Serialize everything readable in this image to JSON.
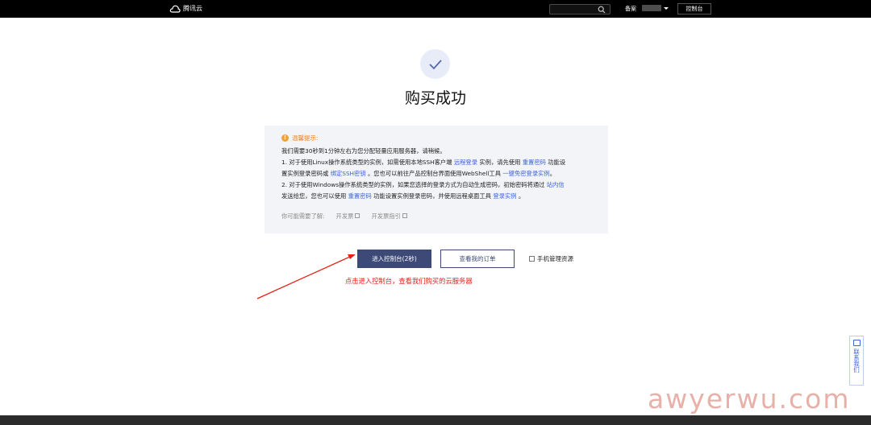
{
  "nav": {
    "logo_text": "腾讯云",
    "search_placeholder": "",
    "beian": "备案",
    "console": "控制台"
  },
  "main": {
    "title": "购买成功"
  },
  "notice": {
    "title": "温馨提示:",
    "line1": "我们需要30秒到1分钟左右为您分配轻量应用服务器，请稍候。",
    "line2_a": "1. 对于使用Linux操作系统类型的实例，如需使用本地SSH客户端 ",
    "line2_link1": "远程登录",
    "line2_b": " 实例，请先使用 ",
    "line2_link2": "重置密码",
    "line2_c": " 功能设",
    "line3_a": "置实例登录密码或 ",
    "line3_link1": "绑定SSH密钥",
    "line3_b": " 。您也可以前往产品控制台界面使用WebShell工具 ",
    "line3_link2": "一键免密登录实例",
    "line3_c": "。",
    "line4_a": "2. 对于使用Windows操作系统类型的实例，如果您选择的登录方式为自动生成密码，初始密码将通过 ",
    "line4_link1": "站内信",
    "line5_a": "发送给您，您也可以使用 ",
    "line5_link1": "重置密码",
    "line5_b": " 功能设置实例登录密码，并使用远程桌面工具 ",
    "line5_link2": "登录实例",
    "line5_c": " 。",
    "more_label": "你可能需要了解:",
    "more_link1": "开发票",
    "more_link2": "开发票指引"
  },
  "actions": {
    "enter_console": "进入控制台(2秒)",
    "view_orders": "查看我的订单",
    "mobile_manage": "手机管理资源"
  },
  "annotation": "点击进入控制台，查看我们购买的云服务器",
  "contact": "联系我们",
  "watermark": "awyerwu.com",
  "colors": {
    "primary": "#3d4a78",
    "link": "#3c64d8",
    "warning": "#e8862a",
    "annotation": "#e2231a"
  }
}
